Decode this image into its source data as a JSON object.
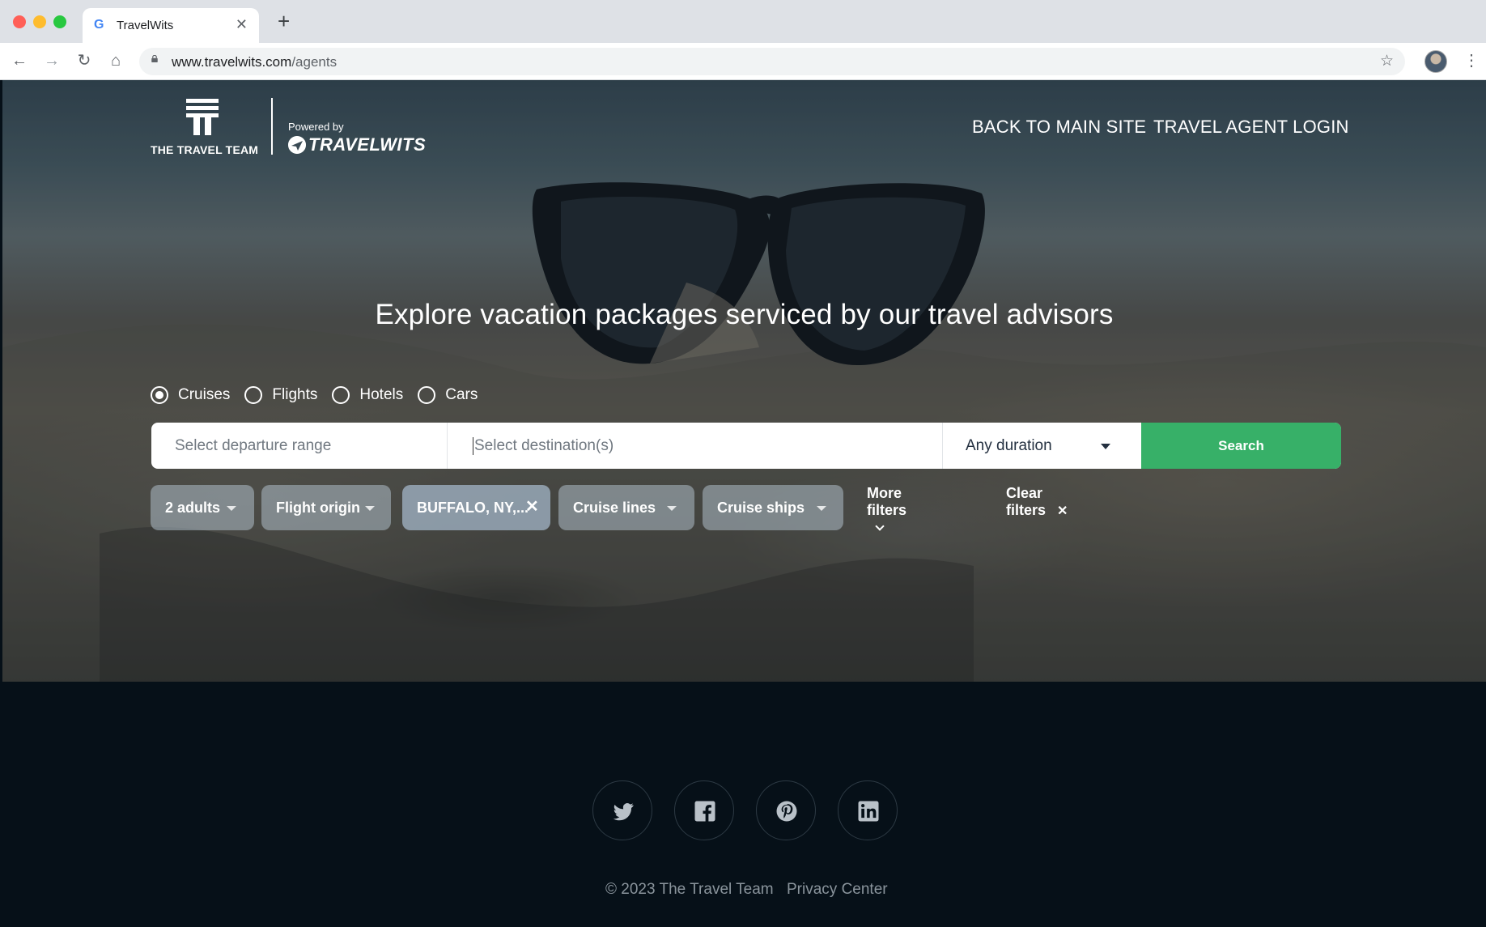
{
  "browser": {
    "tab_title": "TravelWits",
    "tab_favicon": "G",
    "url_host": "www.travelwits.com",
    "url_path": "/agents"
  },
  "header": {
    "logo_name": "THE TRAVEL TEAM",
    "powered_by": "Powered by",
    "brand": "TRAVELWITS",
    "nav_back": "BACK TO MAIN SITE",
    "nav_login": "TRAVEL AGENT LOGIN"
  },
  "hero": {
    "headline": "Explore vacation packages serviced by our travel advisors"
  },
  "search_types": [
    {
      "label": "Cruises",
      "selected": true
    },
    {
      "label": "Flights",
      "selected": false
    },
    {
      "label": "Hotels",
      "selected": false
    },
    {
      "label": "Cars",
      "selected": false
    }
  ],
  "search": {
    "departure_placeholder": "Select departure range",
    "destination_placeholder": "Select destination(s)",
    "duration_value": "Any duration",
    "search_label": "Search"
  },
  "filters": {
    "adults": "2 adults",
    "flight_origin": "Flight origin",
    "origin_selected": "BUFFALO, NY,...",
    "cruise_lines": "Cruise lines",
    "cruise_ships": "Cruise ships",
    "more_filters": "More filters",
    "clear_filters": "Clear filters"
  },
  "footer": {
    "social": [
      "twitter-icon",
      "facebook-icon",
      "pinterest-icon",
      "linkedin-icon"
    ],
    "copyright": "© 2023 The Travel Team",
    "privacy": "Privacy Center"
  },
  "colors": {
    "search_button": "#37b068",
    "footer_bg": "#061018"
  }
}
